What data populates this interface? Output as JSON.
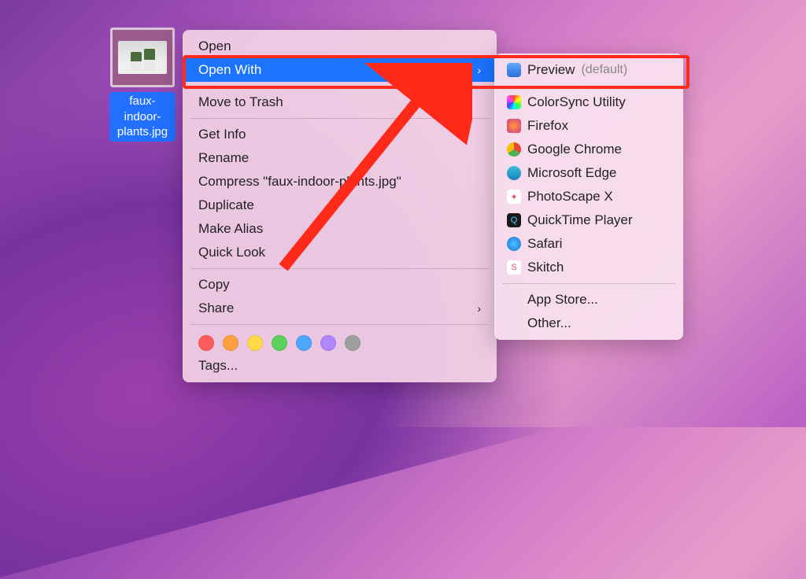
{
  "file": {
    "name": "faux-indoor-plants.jpg"
  },
  "context_menu": {
    "open": "Open",
    "open_with": "Open With",
    "move_to_trash": "Move to Trash",
    "get_info": "Get Info",
    "rename": "Rename",
    "compress": "Compress \"faux-indoor-plants.jpg\"",
    "duplicate": "Duplicate",
    "make_alias": "Make Alias",
    "quick_look": "Quick Look",
    "copy": "Copy",
    "share": "Share",
    "tags": "Tags...",
    "tag_colors": [
      "#ff5c5c",
      "#ff9f40",
      "#ffd94a",
      "#5bd25b",
      "#4da6ff",
      "#b085ff",
      "#9e9e9e"
    ]
  },
  "submenu": {
    "default_app": "Preview",
    "default_suffix": "(default)",
    "apps": [
      "ColorSync Utility",
      "Firefox",
      "Google Chrome",
      "Microsoft Edge",
      "PhotoScape X",
      "QuickTime Player",
      "Safari",
      "Skitch"
    ],
    "app_store": "App Store...",
    "other": "Other..."
  }
}
